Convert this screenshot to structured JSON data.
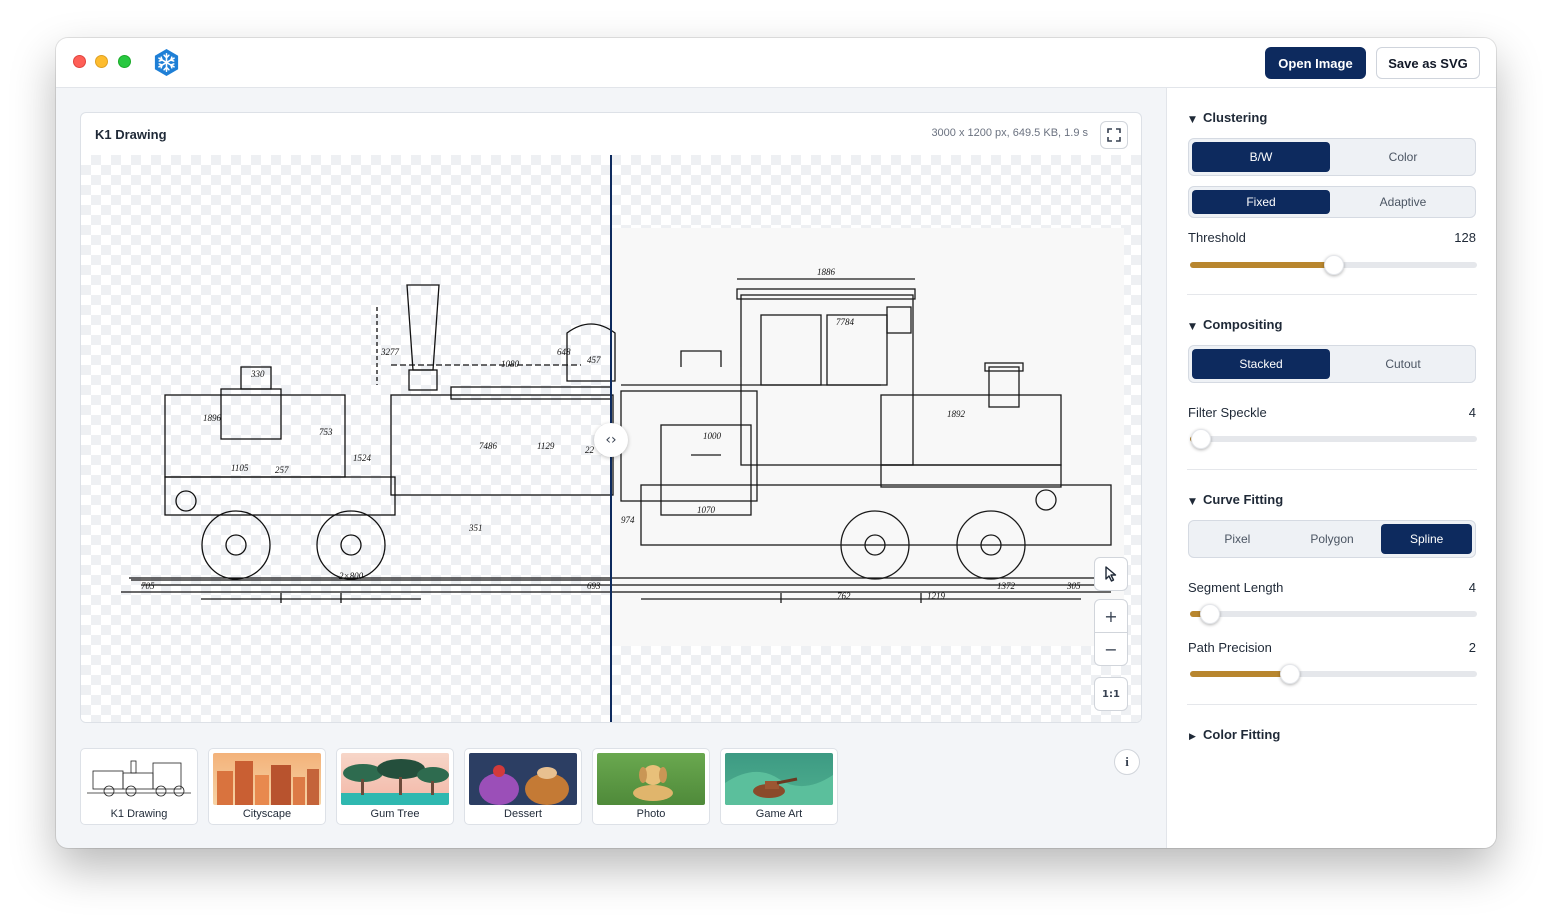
{
  "toolbar": {
    "open_label": "Open Image",
    "save_label": "Save as SVG"
  },
  "canvas": {
    "title": "K1 Drawing",
    "meta": "3000 x 1200 px, 649.5 KB, 1.9 s",
    "zoom_in": "+",
    "zoom_out": "−",
    "actual_size": "1:1",
    "drawing_labels": [
      "1886",
      "7784",
      "1892",
      "1000",
      "1070",
      "974",
      "762",
      "1219",
      "1372",
      "305",
      "693",
      "705",
      "1105",
      "1896",
      "330",
      "457",
      "3277",
      "1080",
      "648",
      "1524",
      "753",
      "7486",
      "1129",
      "22",
      "257",
      "351",
      "2×800"
    ]
  },
  "thumbnails": [
    {
      "label": "K1 Drawing"
    },
    {
      "label": "Cityscape"
    },
    {
      "label": "Gum Tree"
    },
    {
      "label": "Dessert"
    },
    {
      "label": "Photo"
    },
    {
      "label": "Game Art"
    }
  ],
  "panel": {
    "clustering": {
      "title": "Clustering",
      "mode": {
        "options": [
          "B/W",
          "Color"
        ],
        "selected": "B/W"
      },
      "hierarchy": {
        "options": [
          "Fixed",
          "Adaptive"
        ],
        "selected": "Fixed"
      },
      "threshold": {
        "label": "Threshold",
        "value": "128",
        "fraction": 0.5
      }
    },
    "compositing": {
      "title": "Compositing",
      "mode": {
        "options": [
          "Stacked",
          "Cutout"
        ],
        "selected": "Stacked"
      },
      "filter_speckle": {
        "label": "Filter Speckle",
        "value": "4",
        "fraction": 0.04
      }
    },
    "curve_fitting": {
      "title": "Curve Fitting",
      "mode": {
        "options": [
          "Pixel",
          "Polygon",
          "Spline"
        ],
        "selected": "Spline"
      },
      "segment_length": {
        "label": "Segment Length",
        "value": "4",
        "fraction": 0.07
      },
      "path_precision": {
        "label": "Path Precision",
        "value": "2",
        "fraction": 0.35
      }
    },
    "color_fitting": {
      "title": "Color Fitting",
      "collapsed": true
    }
  },
  "colors": {
    "accent": "#0d2a5e",
    "slider": "#b8862e"
  }
}
